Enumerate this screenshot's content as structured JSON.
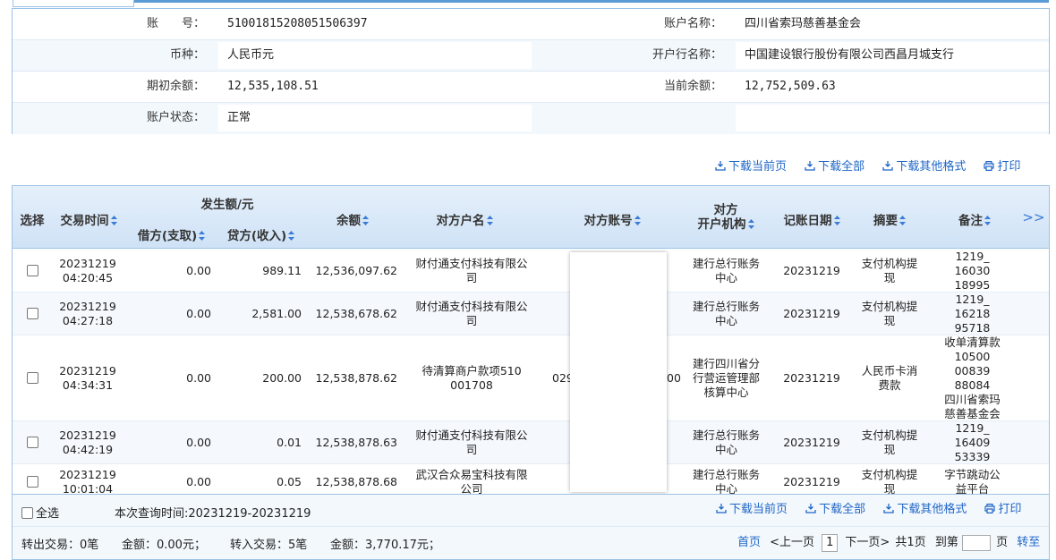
{
  "account": {
    "number_label": "账　　号：",
    "number": "51001815208051506397",
    "name_label": "账户名称：",
    "name": "四川省索玛慈善基金会",
    "currency_label": "币种：",
    "currency": "人民币元",
    "bank_label": "开户行名称：",
    "bank": "中国建设银行股份有限公司西昌月城支行",
    "opening_balance_label": "期初余额：",
    "opening_balance": "12,535,108.51",
    "current_balance_label": "当前余额：",
    "current_balance": "12,752,509.63",
    "status_label": "账户状态：",
    "status": "正常"
  },
  "toolbar": {
    "download_page": "下载当前页",
    "download_all": "下载全部",
    "download_other": "下载其他格式",
    "print": "打印"
  },
  "table": {
    "headers": {
      "select": "选择",
      "time": "交易时间",
      "amount_group": "发生额/元",
      "debit": "借方(支取)",
      "credit": "贷方(收入)",
      "balance": "余额",
      "counterparty_name": "对方户名",
      "counterparty_account": "对方账号",
      "counterparty_bank_l1": "对方",
      "counterparty_bank_l2": "开户机构",
      "post_date": "记账日期",
      "summary": "摘要",
      "remark": "备注",
      "more": ">>"
    },
    "rows": [
      {
        "date": "20231219",
        "time": "04:20:45",
        "debit": "0.00",
        "credit": "989.11",
        "balance": "12,536,097.62",
        "cp_name": [
          "财付通支付科技有限公",
          "司"
        ],
        "cp_account_left": "",
        "cp_account_right": "",
        "cp_bank": [
          "建行总行账务",
          "中心"
        ],
        "post_date": "20231219",
        "summary": [
          "支付机构提",
          "现"
        ],
        "remark": [
          "1219_",
          "16030",
          "18995"
        ]
      },
      {
        "date": "20231219",
        "time": "04:27:18",
        "debit": "0.00",
        "credit": "2,581.00",
        "balance": "12,538,678.62",
        "cp_name": [
          "财付通支付科技有限公",
          "司"
        ],
        "cp_account_left": "",
        "cp_account_right": "",
        "cp_bank": [
          "建行总行账务",
          "中心"
        ],
        "post_date": "20231219",
        "summary": [
          "支付机构提",
          "现"
        ],
        "remark": [
          "1219_",
          "16218",
          "95718"
        ]
      },
      {
        "date": "20231219",
        "time": "04:34:31",
        "debit": "0.00",
        "credit": "200.00",
        "balance": "12,538,878.62",
        "cp_name": [
          "待清算商户款项510",
          "001708"
        ],
        "cp_account_left": "029",
        "cp_account_right": "00",
        "cp_bank": [
          "建行四川省分",
          "行营运管理部",
          "核算中心"
        ],
        "post_date": "20231219",
        "summary": [
          "人民币卡消",
          "费款"
        ],
        "remark": [
          "收单清算款",
          "10500",
          "00839",
          "88084",
          "四川省索玛",
          "慈善基金会"
        ]
      },
      {
        "date": "20231219",
        "time": "04:42:19",
        "debit": "0.00",
        "credit": "0.01",
        "balance": "12,538,878.63",
        "cp_name": [
          "财付通支付科技有限公",
          "司"
        ],
        "cp_account_left": "",
        "cp_account_right": "",
        "cp_bank": [
          "建行总行账务",
          "中心"
        ],
        "post_date": "20231219",
        "summary": [
          "支付机构提",
          "现"
        ],
        "remark": [
          "1219_",
          "16409",
          "53339"
        ]
      },
      {
        "date": "20231219",
        "time": "10:01:04",
        "debit": "0.00",
        "credit": "0.05",
        "balance": "12,538,878.68",
        "cp_name": [
          "武汉合众易宝科技有限",
          "公司"
        ],
        "cp_account_left": "",
        "cp_account_right": "",
        "cp_bank": [
          "建行总行账务",
          "中心"
        ],
        "post_date": "20231219",
        "summary": [
          "支付机构提",
          "现"
        ],
        "remark": [
          "字节跳动公",
          "益平台"
        ]
      }
    ]
  },
  "footer": {
    "select_all": "全选",
    "query_time": "本次查询时间:20231219-20231219",
    "out_summary": "转出交易：0笔",
    "out_amount": "金额：0.00元；",
    "in_summary": "转入交易：5笔",
    "in_amount": "金额：3,770.17元；",
    "first_page": "首页",
    "prev_page": "<上一页",
    "current_page": "1",
    "next_page": "下一页>",
    "total_pages": "共1页",
    "goto_label": "到第",
    "page_unit": "页",
    "goto_button": "转至"
  },
  "colors": {
    "accent": "#1f66c7",
    "header_bg": "#cfe2f6",
    "border": "#9dc3e6"
  }
}
